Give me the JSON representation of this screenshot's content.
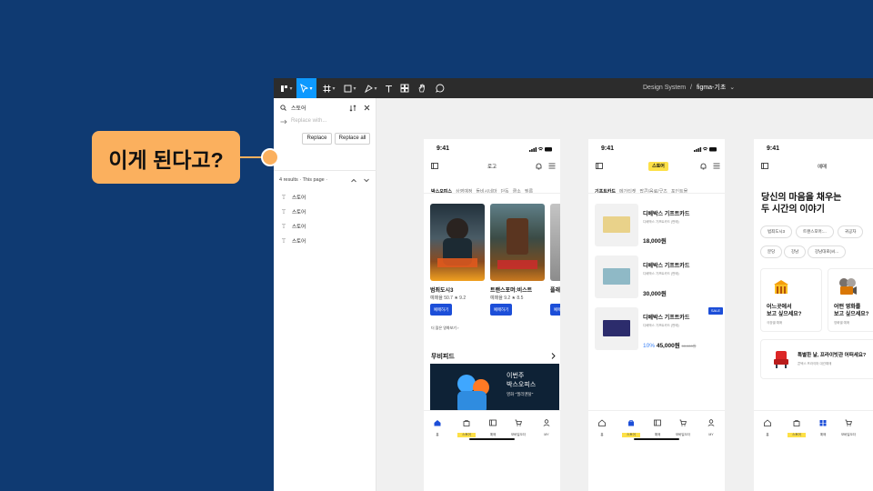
{
  "colors": {
    "background": "#0f3a72",
    "accent": "#0d99ff",
    "callout": "#fbb05e",
    "brand_blue": "#1c4ed8",
    "highlight_yellow": "#fde047"
  },
  "callout": {
    "text": "이게 된다고?"
  },
  "figma": {
    "doc_path": {
      "project": "Design System",
      "separator": "/",
      "file": "figma-기초",
      "caret": "⌄"
    },
    "find": {
      "query": "스토어",
      "replace_placeholder": "Replace with...",
      "replace_button": "Replace",
      "replace_all_button": "Replace all",
      "results_label": "4 results · This page ·"
    },
    "results": [
      {
        "label": "스토어"
      },
      {
        "label": "스토어"
      },
      {
        "label": "스토어"
      },
      {
        "label": "스토어"
      }
    ]
  },
  "frame1": {
    "time": "9:41",
    "logo": "로고",
    "tabs": [
      "박스오피스",
      "상영예정",
      "돌비시네마",
      "단독",
      "클소",
      "필름"
    ],
    "movies": [
      {
        "title": "범죄도시3",
        "rate": "예매율 50.7",
        "star": "★ 9.2",
        "book": "예매하기"
      },
      {
        "title": "트랜스포머:비스트",
        "rate": "예매율 9.2",
        "star": "★ 8.5",
        "book": "예매하기"
      },
      {
        "title": "플래시",
        "rate": "",
        "star": "",
        "book": "예매하기"
      }
    ],
    "more_link": "더 많은 영화보기",
    "section": "무비피드",
    "banner": {
      "line1": "이번주",
      "line2": "박스오피스",
      "sub": "엘리멘탈"
    },
    "tabbar": [
      "홈",
      "스토어",
      "예매",
      "모바일오더",
      "MY"
    ]
  },
  "frame2": {
    "time": "9:41",
    "chip": "스토어",
    "tabs": [
      "기프트카드",
      "메가티켓",
      "팝콘/음료/굿즈",
      "포인트몰"
    ],
    "items": [
      {
        "title": "디베박스 기프트카드",
        "sub": "디베박스 기프트카드 (판매)",
        "price": "18,000원",
        "color": "#e9d28a"
      },
      {
        "title": "디베박스 기프트카드",
        "sub": "디베박스 기프트카드 (판매)",
        "price": "30,000원",
        "color": "#8fb9c6"
      },
      {
        "title": "디베박스 기프트카드",
        "sub": "디베박스 기프트카드 (판매)",
        "price": "45,000원",
        "discount": "10%",
        "original": "50,000원",
        "color": "#2c2c6c"
      }
    ],
    "sale": "SALE",
    "tabbar": [
      "홈",
      "스토어",
      "예매",
      "모바일오더",
      "MY"
    ]
  },
  "frame3": {
    "time": "9:41",
    "title": "예매",
    "headline1": "당신의 마음을 채우는",
    "headline2": "두 시간의 이야기",
    "chips": [
      "범죄도시3",
      "트랜스포머:...",
      "귀공자",
      "분당",
      "강남",
      "강남대로(씨..."
    ],
    "card1": {
      "title1": "어느곳에서",
      "title2": "보고 싶으세요?",
      "sub": "극장별 예매"
    },
    "card2": {
      "title1": "어떤 영화를",
      "title2": "보고 싶으세요?",
      "sub": "영화별 예매"
    },
    "wide": {
      "title": "특별한 날, 프라이빗관 어떠세요?",
      "sub": "콘텍스 프라이머 대관예매"
    },
    "tabbar": [
      "홈",
      "스토어",
      "예매",
      "모바일오더",
      "MY"
    ]
  }
}
